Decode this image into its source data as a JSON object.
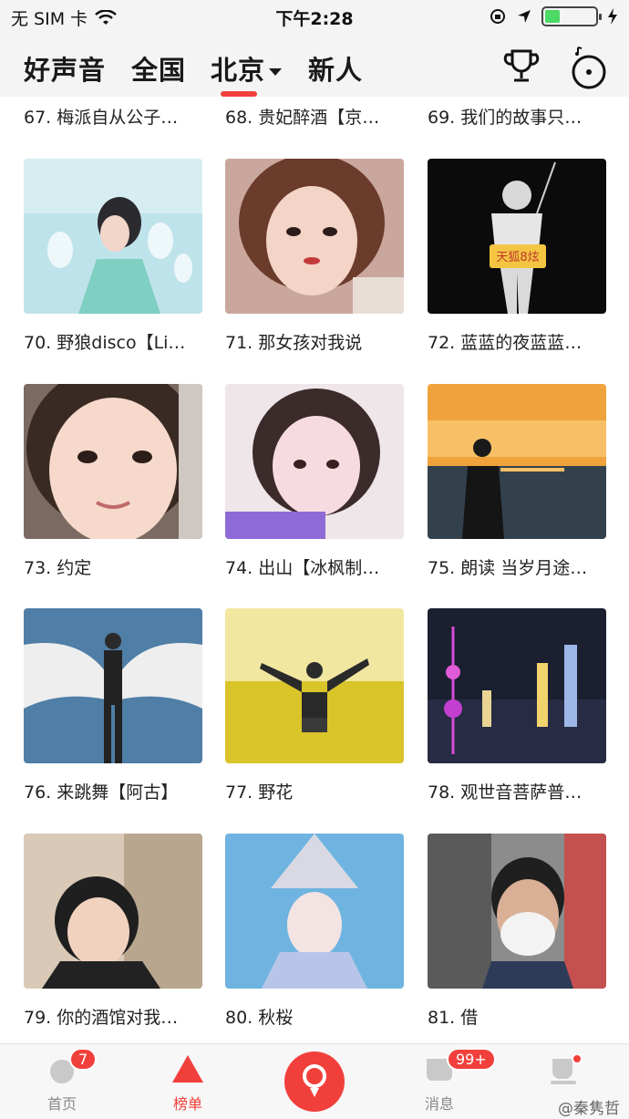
{
  "status_bar": {
    "carrier": "无 SIM 卡",
    "time": "下午2:28",
    "battery_level": 0.3
  },
  "header": {
    "tabs": [
      {
        "label": "好声音"
      },
      {
        "label": "全国"
      },
      {
        "label": "北京"
      },
      {
        "label": "新人"
      }
    ],
    "active_tab": "北京"
  },
  "songs_prev_row": [
    {
      "title": "67. 梅派自从公子…"
    },
    {
      "title": "68. 贵妃醉酒【京…"
    },
    {
      "title": "69. 我们的故事只…"
    }
  ],
  "songs": [
    {
      "title": "70. 野狼disco【Li…"
    },
    {
      "title": "71. 那女孩对我说"
    },
    {
      "title": "72. 蓝蓝的夜蓝蓝…"
    },
    {
      "title": "73. 约定"
    },
    {
      "title": "74. 出山【冰枫制…"
    },
    {
      "title": "75. 朗读 当岁月途…"
    },
    {
      "title": "76. 来跳舞【阿古】"
    },
    {
      "title": "77. 野花"
    },
    {
      "title": "78. 观世音菩萨普…"
    },
    {
      "title": "79. 你的酒馆对我…"
    },
    {
      "title": "80. 秋桜"
    },
    {
      "title": "81. 借"
    }
  ],
  "cover_badge_text": "天狐8炫",
  "bottom_nav": {
    "home_label": "首页",
    "home_badge": "7",
    "chart_label": "榜单",
    "messages_label": "消息",
    "messages_badge": "99+",
    "watermark": "@秦隽哲"
  },
  "colors": {
    "accent": "#f1403c",
    "status_bar_bg": "#f4f4f4",
    "battery": "#4cd964"
  }
}
